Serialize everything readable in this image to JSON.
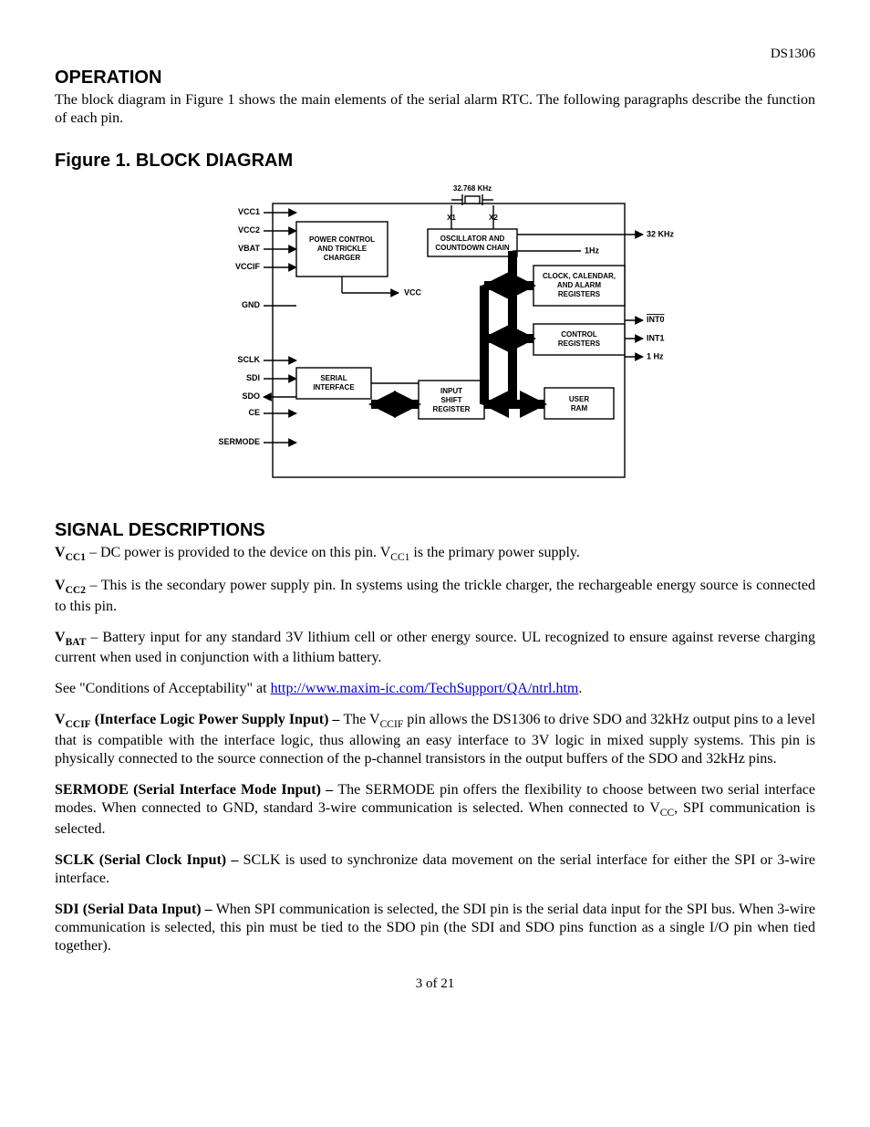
{
  "header": {
    "part_number": "DS1306"
  },
  "sections": {
    "operation_heading": "OPERATION",
    "operation_body": "The block diagram in Figure 1 shows the main elements of the serial alarm RTC. The following paragraphs describe the function of each pin.",
    "figure_heading": "Figure 1. BLOCK DIAGRAM",
    "signal_heading": "SIGNAL DESCRIPTIONS"
  },
  "diagram": {
    "top_label": "32.768 KHz",
    "pins_left": [
      "VCC1",
      "VCC2",
      "VBAT",
      "VCCIF",
      "GND",
      "SCLK",
      "SDI",
      "SDO",
      "CE",
      "SERMODE"
    ],
    "blocks": {
      "power": [
        "POWER CONTROL",
        "AND TRICKLE",
        "CHARGER"
      ],
      "osc": [
        "OSCILLATOR AND",
        "COUNTDOWN CHAIN"
      ],
      "clock": [
        "CLOCK, CALENDAR,",
        "AND ALARM",
        "REGISTERS"
      ],
      "control": [
        "CONTROL",
        "REGISTERS"
      ],
      "serial": [
        "SERIAL",
        "INTERFACE"
      ],
      "shift": [
        "INPUT",
        "SHIFT",
        "REGISTER"
      ],
      "ram": [
        "USER",
        "RAM"
      ]
    },
    "osc_pins": [
      "X1",
      "X2"
    ],
    "right_labels": [
      "32 KHz",
      "1Hz",
      "INT0",
      "INT1",
      "1 Hz"
    ],
    "vcc_arrow": "VCC"
  },
  "signals": {
    "vcc1_pre": "V",
    "vcc1_sub": "CC1",
    "vcc1_sep": " – ",
    "vcc1_body_a": "DC power is provided to the device on this pin. V",
    "vcc1_body_b": " is the primary power supply.",
    "vcc2_pre": "V",
    "vcc2_sub": "CC2",
    "vcc2_sep": " – ",
    "vcc2_body": "This is the secondary power supply pin. In systems using the trickle charger, the rechargeable energy source is connected to this pin.",
    "vbat_pre": "V",
    "vbat_sub": "BAT",
    "vbat_sep": " – ",
    "vbat_body": "Battery input for any standard 3V lithium cell or other energy source. UL recognized to ensure against reverse charging current when used in conjunction with a lithium battery.",
    "see_pre": "See \"Conditions of Acceptability\" at ",
    "see_link": "http://www.maxim-ic.com/TechSupport/QA/ntrl.htm",
    "see_post": ".",
    "vccif_pre": "V",
    "vccif_sub": "CCIF",
    "vccif_title": " (Interface Logic Power Supply Input) – ",
    "vccif_body_a": "The V",
    "vccif_body_b": " pin allows the DS1306 to drive SDO and 32kHz output pins to a level that is compatible with the interface logic, thus allowing an easy interface to 3V logic in mixed supply systems. This pin is physically connected to the source connection of the p-channel transistors in the output buffers of the SDO and 32kHz pins.",
    "sermode_title": "SERMODE (Serial Interface Mode Input) – ",
    "sermode_body_a": "The SERMODE pin offers the flexibility to choose between two serial interface modes. When connected to GND, standard 3-wire communication is selected. When connected to V",
    "sermode_body_b": ", SPI communication is selected.",
    "sermode_sub": "CC",
    "sclk_title": "SCLK (Serial Clock Input) – ",
    "sclk_body": "SCLK is used to synchronize data movement on the serial interface for either the SPI or 3-wire interface.",
    "sdi_title": "SDI (Serial Data Input) – ",
    "sdi_body": "When SPI communication is selected, the SDI pin is the serial data input for the SPI bus. When 3-wire communication is selected, this pin must be tied to the SDO pin (the SDI and SDO pins function as a single I/O pin when tied together)."
  },
  "footer": {
    "page": "3 of 21"
  }
}
